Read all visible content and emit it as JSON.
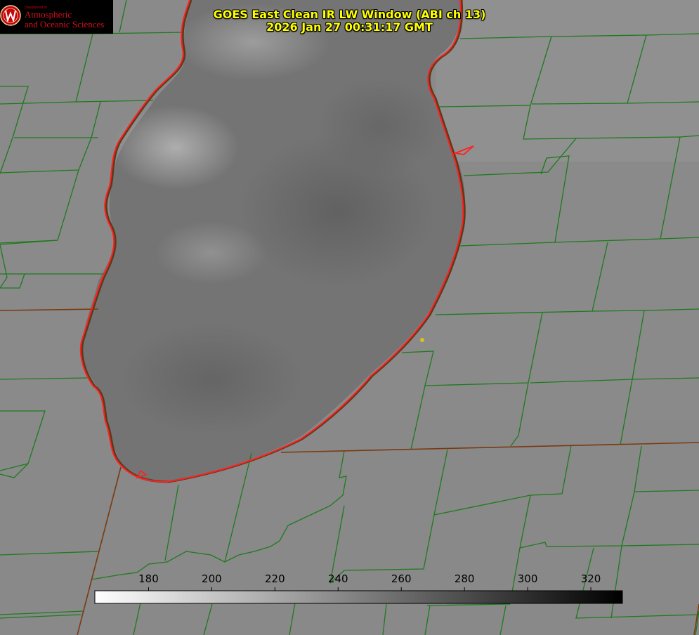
{
  "logo": {
    "department": "Department of",
    "line1": "Atmospheric",
    "line2": "and Oceanic Sciences",
    "seal_letter": "W",
    "brand_color": "#c5050c"
  },
  "title": {
    "line1": "GOES East Clean IR LW Window (ABI ch 13)",
    "line2": "2026 Jan 27 00:31:17 GMT",
    "color": "#ffff00"
  },
  "colorbar": {
    "min": 163,
    "max": 330,
    "ticks": [
      "180",
      "200",
      "220",
      "240",
      "260",
      "280",
      "300",
      "320"
    ],
    "tick_values": [
      180,
      200,
      220,
      240,
      260,
      280,
      300,
      320
    ],
    "colormap": "white-to-black greyscale"
  },
  "map": {
    "lake_outline_color": "#ff2020",
    "boundary_color": "#1e7a1e",
    "state_boundary_color": "#7a3a10",
    "marker_color": "#d8c020"
  }
}
